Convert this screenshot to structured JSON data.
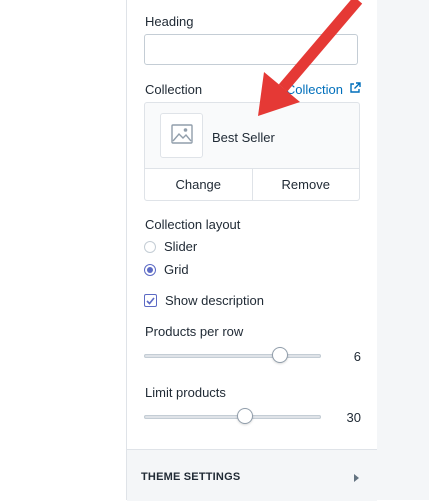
{
  "sidebar": {
    "heading_label": "Heading",
    "heading_value": "",
    "collection_label": "Collection",
    "edit_collection_link": "Collection",
    "selected_collection": "Best Seller",
    "change_button": "Change",
    "remove_button": "Remove",
    "layout_label": "Collection layout",
    "layout_options": [
      {
        "label": "Slider",
        "checked": false
      },
      {
        "label": "Grid",
        "checked": true
      }
    ],
    "show_description_label": "Show description",
    "show_description_checked": true,
    "products_per_row_label": "Products per row",
    "products_per_row_value": "6",
    "products_per_row_fraction": 0.77,
    "limit_products_label": "Limit products",
    "limit_products_value": "30",
    "limit_products_fraction": 0.57
  },
  "footer": {
    "title": "THEME SETTINGS"
  },
  "icons": {
    "external_link": "external-link-icon",
    "image_placeholder": "image-placeholder-icon",
    "checkmark": "checkmark-icon",
    "caret": "caret-right-icon"
  },
  "colors": {
    "accent": "#5c6ac4",
    "link": "#006fbb",
    "annotation_arrow": "#e53935"
  }
}
